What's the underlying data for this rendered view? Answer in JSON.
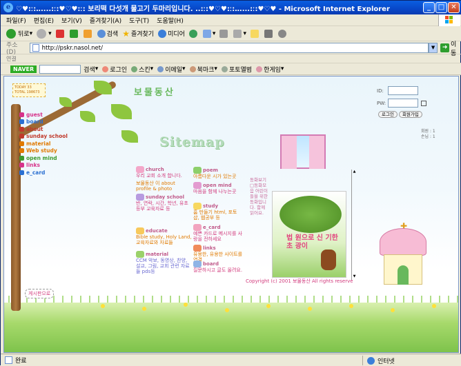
{
  "window": {
    "title": "♡♥:ː:‥....:ː:♥♡♥:ː: 보리떡 다섯개 물고기 두마리입니다. ..:ː:♥♡♥:ː:‥....:ː:♥♡♥ - Microsoft Internet Explorer",
    "controls": {
      "minimize": "_",
      "maximize": "□",
      "close": "✕"
    }
  },
  "menubar": [
    "파일(F)",
    "편집(E)",
    "보기(V)",
    "즐겨찾기(A)",
    "도구(T)",
    "도움말(H)"
  ],
  "toolbar": {
    "back": "뒤로",
    "search": "검색",
    "favorites": "즐겨찾기",
    "media": "미디어"
  },
  "address": {
    "label": "주소(D)",
    "url": "http://pskr.nasol.net/",
    "go": "이동"
  },
  "links_label": "연결",
  "naverbar": {
    "logo": "NAVER",
    "items": [
      "검색",
      "로그인",
      "스킨",
      "이메일",
      "북마크",
      "포토앨범",
      "한게임"
    ]
  },
  "site": {
    "logo": "보물동산",
    "sitemap_title": "Sitemap",
    "counter": "TODAY 33 TOTAL 198673",
    "nav": [
      {
        "label": "guest",
        "color": "#d6338a"
      },
      {
        "label": "board",
        "color": "#2a6fd1"
      },
      {
        "label": "about",
        "color": "#c0392b"
      },
      {
        "label": "sunday school",
        "color": "#c0392b"
      },
      {
        "label": "material",
        "color": "#e07a00"
      },
      {
        "label": "Web study",
        "color": "#e07a00"
      },
      {
        "label": "open mind",
        "color": "#3c9a2e"
      },
      {
        "label": "links",
        "color": "#d6338a"
      },
      {
        "label": "e_card",
        "color": "#2a6fd1"
      }
    ],
    "login": {
      "id_label": "ID:",
      "pw_label": "PW:",
      "login_btn": "로그인",
      "join_btn": "회원가입"
    },
    "visits": {
      "members": "회원 : 1",
      "guests": "손님 : 1"
    },
    "categories": [
      {
        "title": "church",
        "desc": "우리 교회 소개 합니다."
      },
      {
        "title": "about",
        "desc": "보물동산 이 about profile & photo"
      },
      {
        "title": "sunday school",
        "desc": "반, 연락, 시간, 학년, 유초등부 교육자료 등"
      },
      {
        "title": "educate",
        "desc": "Bible study, Holy Land, 교육자료와 자료들"
      },
      {
        "title": "material",
        "desc": "CCM 악보, 동영상, 찬양, 설교, 그림, 교회 관련 자료들 pds등"
      },
      {
        "title": "poem",
        "desc": "아름다운 시가 있는곳"
      },
      {
        "title": "open mind",
        "desc": "마음을 함께 나누는곳"
      },
      {
        "title": "study",
        "desc": "홈 만들기 html, 포토샵, 웹공부 등"
      },
      {
        "title": "e_card",
        "desc": "예쁜 카드로 메시지를 사랑을 전하세요"
      },
      {
        "title": "links",
        "desc": "유용한, 유용한 사이트를 연결"
      },
      {
        "title": "board",
        "desc": "질문하시고 글도 올려요."
      }
    ],
    "side_text": "동화보기 □동화모음 어린이들을 위한 동화입니다. 함께 읽어요.",
    "story_title": "법 원으로 신 기한 초 광이",
    "copyright": "Copyright (c) 2001 보물동산 All rights reserve",
    "guest_link": "게시판으로",
    "fan_label": "동화보기"
  },
  "status": {
    "text": "완료",
    "zone": "인터넷"
  }
}
